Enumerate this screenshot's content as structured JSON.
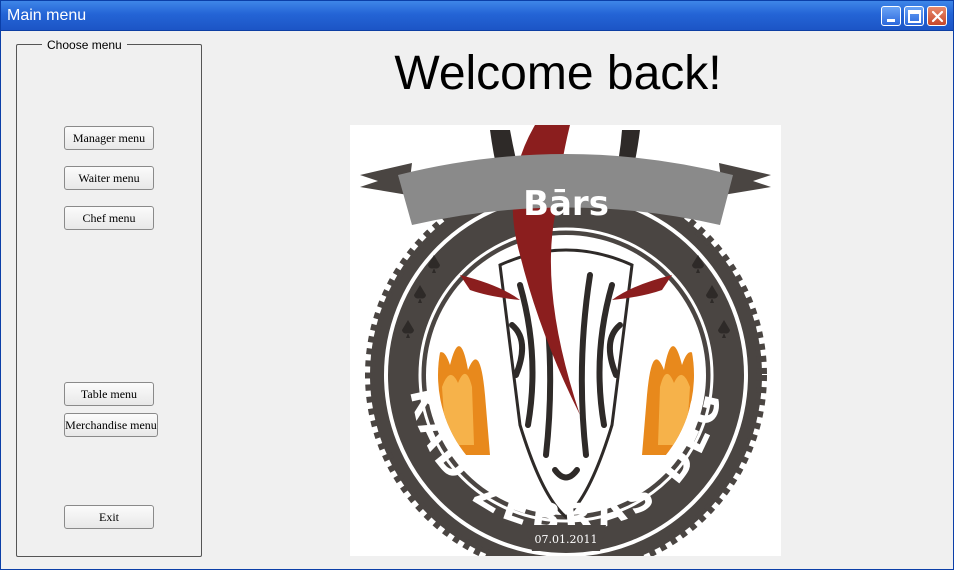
{
  "window": {
    "title": "Main menu"
  },
  "sidebar": {
    "legend": "Choose menu",
    "buttons": {
      "manager": "Manager menu",
      "waiter": "Waiter menu",
      "chef": "Chef menu",
      "table": "Table menu",
      "merchandise": "Merchandise menu",
      "exit": "Exit"
    }
  },
  "main": {
    "welcome": "Welcome back!"
  },
  "logo": {
    "banner_text": "Bārs",
    "ring_text": "KAD ZEBRAS DEG",
    "date_text": "07.01.2011"
  },
  "colors": {
    "titlebar": "#2464d6",
    "window_bg": "#f0f0f0",
    "logo_ring": "#4a4542",
    "logo_banner": "#8a8a8a",
    "logo_red": "#8b1e1e",
    "logo_flame": "#e8891c"
  }
}
